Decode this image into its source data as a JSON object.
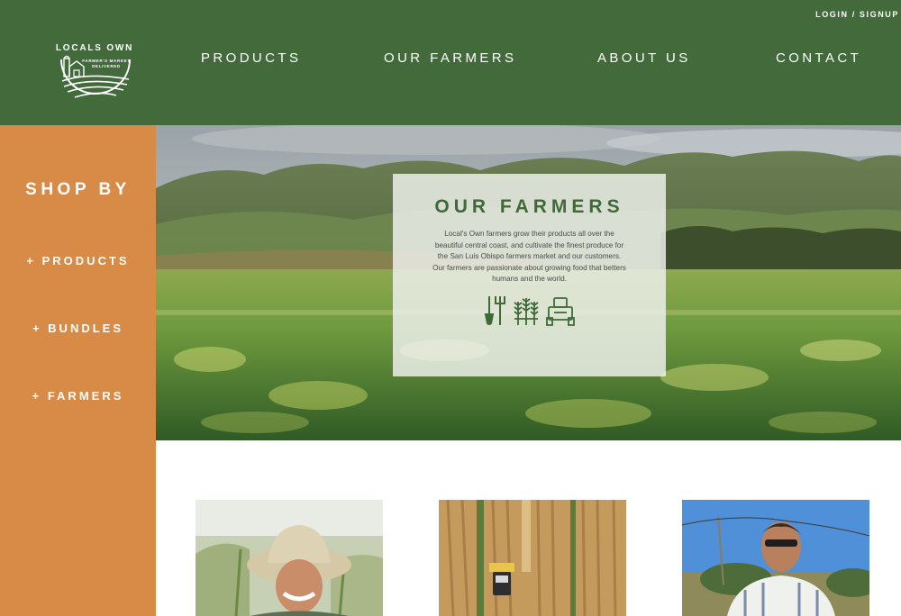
{
  "header": {
    "logo_text": "LOCALS OWN",
    "logo_tagline_1": "FARMER'S MARKET",
    "logo_tagline_2": "DELIVERED",
    "login_label": "LOGIN / SIGNUP",
    "nav": [
      "PRODUCTS",
      "OUR FARMERS",
      "ABOUT US",
      "CONTACT"
    ]
  },
  "sidebar": {
    "heading": "SHOP BY",
    "links": [
      "+ PRODUCTS",
      "+ BUNDLES",
      "+ FARMERS"
    ]
  },
  "hero": {
    "title": "OUR FARMERS",
    "text": "Local's Own farmers grow their products all over the beautiful central coast, and cultivate the finest produce for the San Luis Obispo farmers market and our customers. Our farmers are passionate about growing food that betters humans and the world.",
    "icons": [
      "garden-tools-icon",
      "wheat-icon",
      "tractor-icon"
    ]
  },
  "farmers": [
    {
      "photo": "smiling-farmer-in-hat-photo"
    },
    {
      "photo": "harvester-in-field-aerial-photo"
    },
    {
      "photo": "young-farmer-outdoors-photo"
    }
  ],
  "colors": {
    "header_green": "#426a3b",
    "sidebar_orange": "#d88a47",
    "title_green": "#3f6a37",
    "text": "#ffffff"
  }
}
